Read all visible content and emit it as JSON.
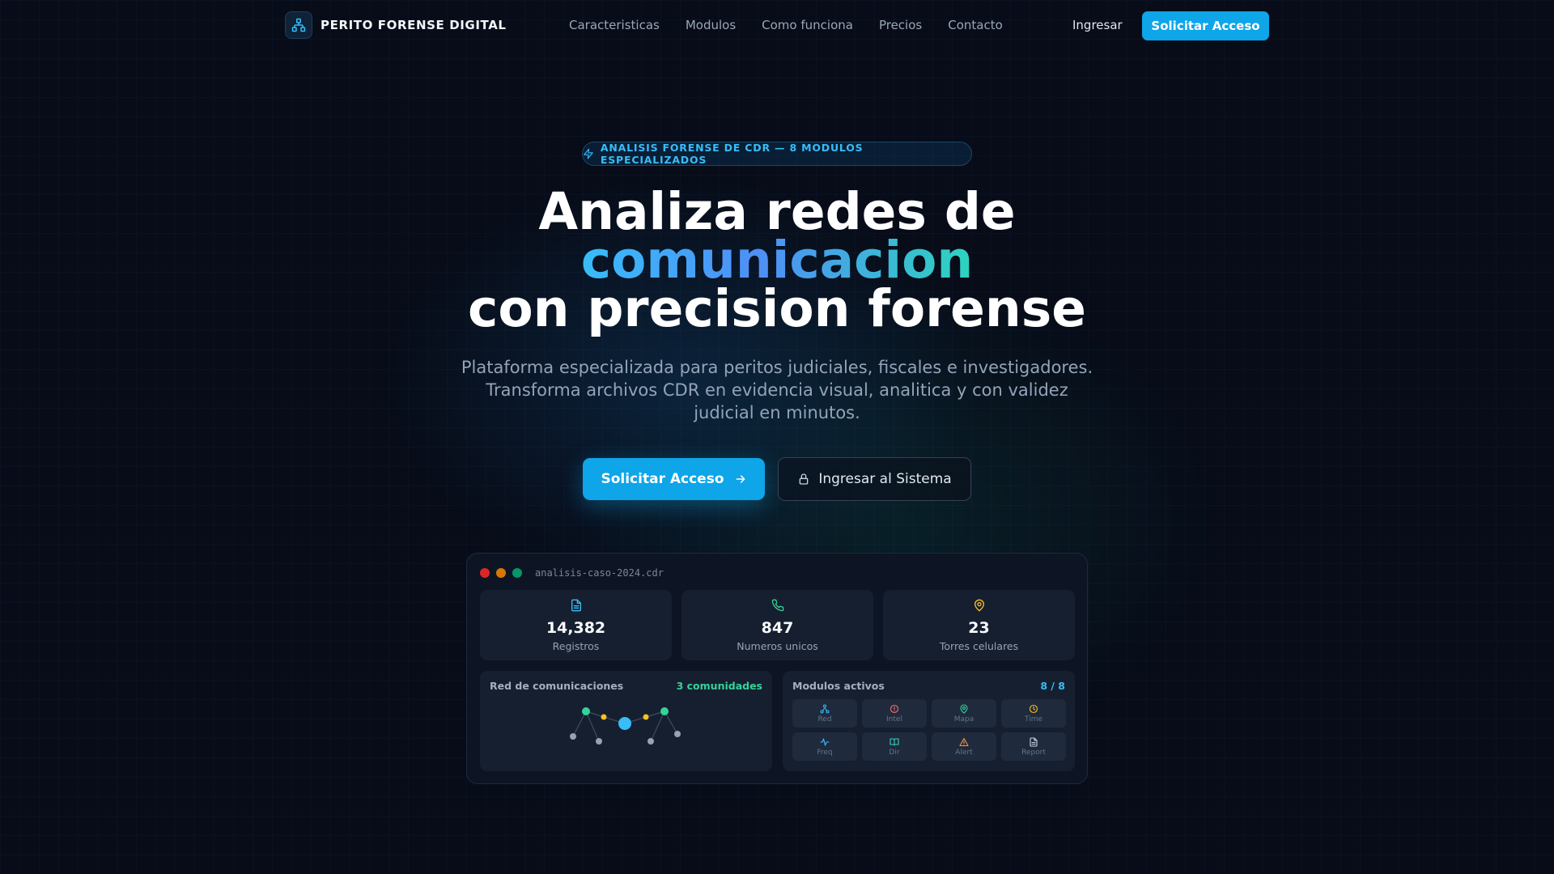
{
  "nav": {
    "brand": "PERITO FORENSE DIGITAL",
    "links": [
      "Caracteristicas",
      "Modulos",
      "Como funciona",
      "Precios",
      "Contacto"
    ],
    "login": "Ingresar",
    "cta": "Solicitar Acceso"
  },
  "hero": {
    "badge": "ANALISIS FORENSE DE CDR — 8 MODULOS ESPECIALIZADOS",
    "title_line1": "Analiza redes de",
    "title_line2": "comunicacion",
    "title_line3": "con precision forense",
    "subtitle": "Plataforma especializada para peritos judiciales, fiscales e investigadores. Transforma archivos CDR en evidencia visual, analitica y con validez judicial en minutos.",
    "primary_button": "Solicitar Acceso",
    "secondary_button": "Ingresar al Sistema"
  },
  "dashboard": {
    "file_name": "analisis-caso-2024.cdr",
    "stats": [
      {
        "value": "14,382",
        "label": "Registros",
        "icon": "file-icon",
        "color": "#38bdf8"
      },
      {
        "value": "847",
        "label": "Numeros unicos",
        "icon": "phone-icon",
        "color": "#34d399"
      },
      {
        "value": "23",
        "label": "Torres celulares",
        "icon": "map-pin-icon",
        "color": "#fbbf24"
      }
    ],
    "network_panel": {
      "title": "Red de comunicaciones",
      "meta": "3 comunidades",
      "meta_color": "#34d399"
    },
    "modules_panel": {
      "title": "Modulos activos",
      "meta": "8 / 8",
      "meta_color": "#38bdf8",
      "modules": [
        {
          "label": "Red",
          "icon": "network-icon",
          "color": "#38bdf8"
        },
        {
          "label": "Intel",
          "icon": "alert-circle-icon",
          "color": "#f87171"
        },
        {
          "label": "Mapa",
          "icon": "map-pin-icon",
          "color": "#34d399"
        },
        {
          "label": "Time",
          "icon": "clock-icon",
          "color": "#fbbf24"
        },
        {
          "label": "Freq",
          "icon": "activity-icon",
          "color": "#38bdf8"
        },
        {
          "label": "Dir",
          "icon": "book-icon",
          "color": "#2dd4bf"
        },
        {
          "label": "Alert",
          "icon": "warning-icon",
          "color": "#fb923c"
        },
        {
          "label": "Report",
          "icon": "document-icon",
          "color": "#cbd5e1"
        }
      ]
    }
  },
  "colors": {
    "accent": "#0ea5e9",
    "background": "#070c18"
  }
}
